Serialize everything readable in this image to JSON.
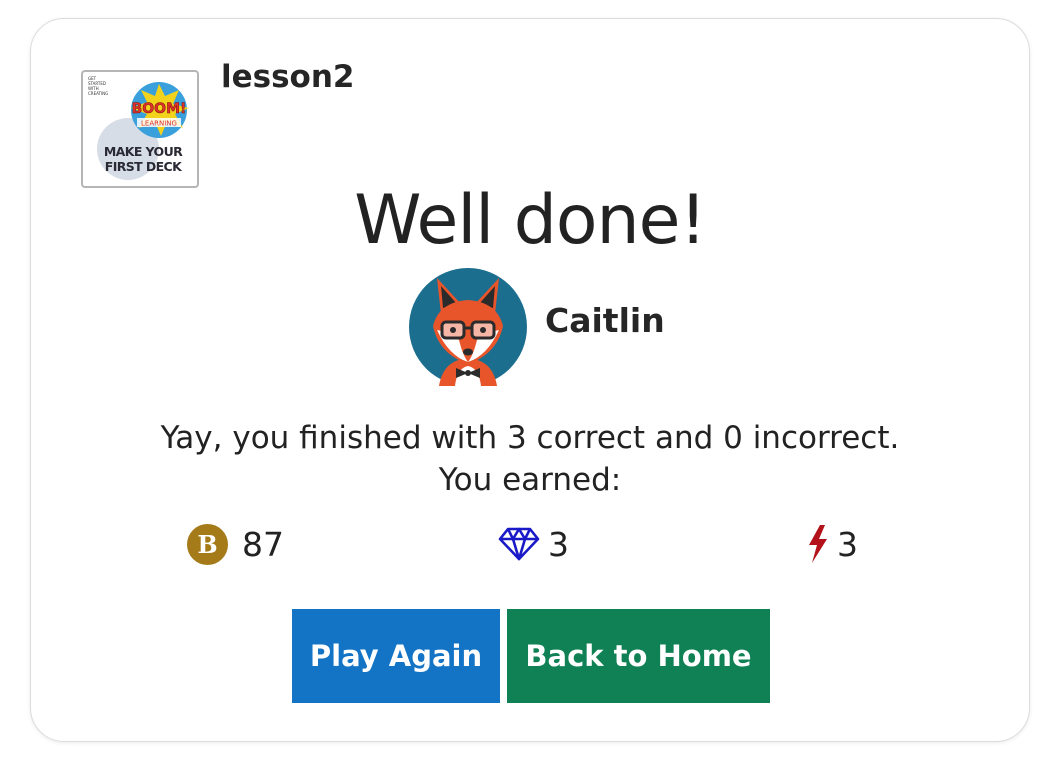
{
  "deck": {
    "title": "lesson2",
    "thumbnail": {
      "small_text": [
        "GET",
        "STARTED",
        "WITH",
        "CREATING"
      ],
      "brand": "BOOM!",
      "brand_sub": "LEARNING",
      "title_lines": [
        "MAKE YOUR",
        "FIRST DECK"
      ]
    }
  },
  "result": {
    "headline": "Well done!",
    "user": {
      "name": "Caitlin",
      "avatar_icon": "fox-avatar-icon"
    },
    "message_line1": "Yay, you finished with 3 correct and 0 incorrect.",
    "message_line2": "You earned:"
  },
  "rewards": {
    "coins": {
      "icon": "boom-coin-icon",
      "symbol": "B",
      "value": "87",
      "color": "#a57a19"
    },
    "gems": {
      "icon": "diamond-icon",
      "value": "3",
      "color": "#1a1ac8"
    },
    "power": {
      "icon": "lightning-bolt-icon",
      "value": "3",
      "color": "#b3121b"
    }
  },
  "actions": {
    "play_again_label": "Play Again",
    "back_home_label": "Back to Home",
    "play_again_color": "#1374c6",
    "back_home_color": "#108154"
  }
}
